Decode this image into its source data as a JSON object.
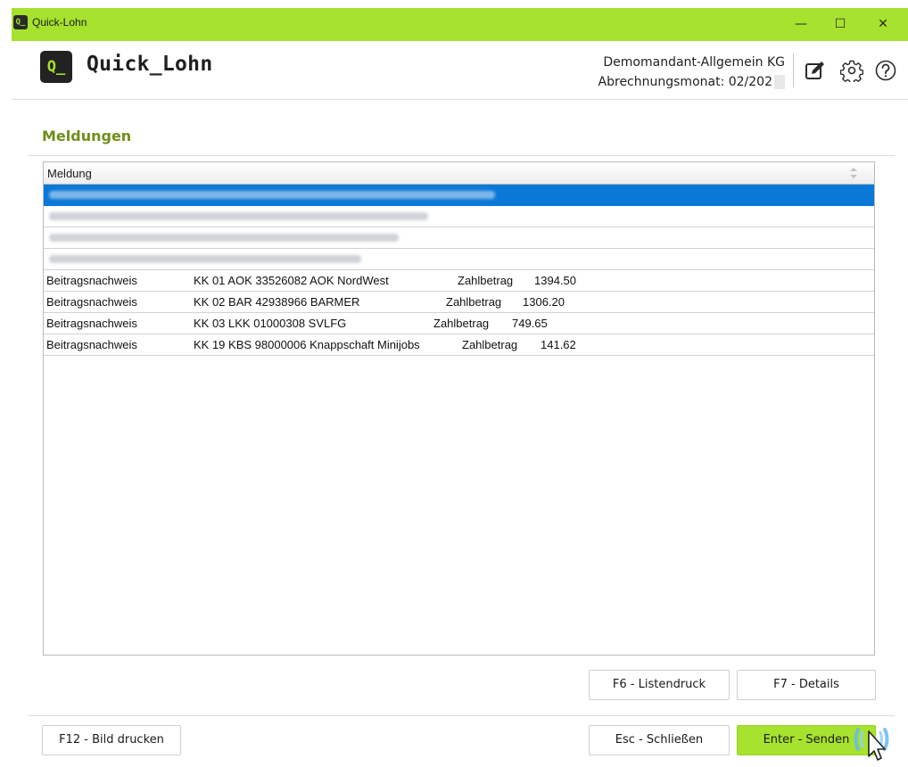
{
  "window": {
    "title": "Quick-Lohn",
    "minimize_symbol": "—",
    "maximize_symbol": "☐",
    "close_symbol": "✕"
  },
  "header": {
    "logo_mark": "Q_",
    "logo_text": "Quick_Lohn",
    "company": "Demomandant-Allgemein KG",
    "month": "Abrechnungsmonat: 02/202",
    "icons": [
      "edit-icon",
      "gear-icon",
      "help-icon"
    ]
  },
  "section": {
    "title": "Meldungen"
  },
  "grid": {
    "column_header": "Meldung",
    "rows": [
      {
        "type": "Beitragsnachweis",
        "kk": "KK 01 AOK 33526082 AOK NordWest",
        "label": "Zahlbetrag",
        "amount": "1394.50"
      },
      {
        "type": "Beitragsnachweis",
        "kk": "KK 02 BAR 42938966 BARMER",
        "label": "Zahlbetrag",
        "amount": "1306.20"
      },
      {
        "type": "Beitragsnachweis",
        "kk": "KK 03 LKK 01000308 SVLFG",
        "label": "Zahlbetrag",
        "amount": "749.65"
      },
      {
        "type": "Beitragsnachweis",
        "kk": "KK 19 KBS 98000006 Knappschaft Minijobs",
        "label": "Zahlbetrag",
        "amount": "141.62"
      }
    ]
  },
  "buttons": {
    "listendruck": "F6 - Listendruck",
    "details": "F7 - Details",
    "bild_drucken": "F12 - Bild drucken",
    "schliessen": "Esc - Schließen",
    "senden": "Enter - Senden"
  },
  "colors": {
    "accent": "#a6e22e",
    "section_title": "#6f8f1a",
    "selection": "#0a78d7"
  }
}
